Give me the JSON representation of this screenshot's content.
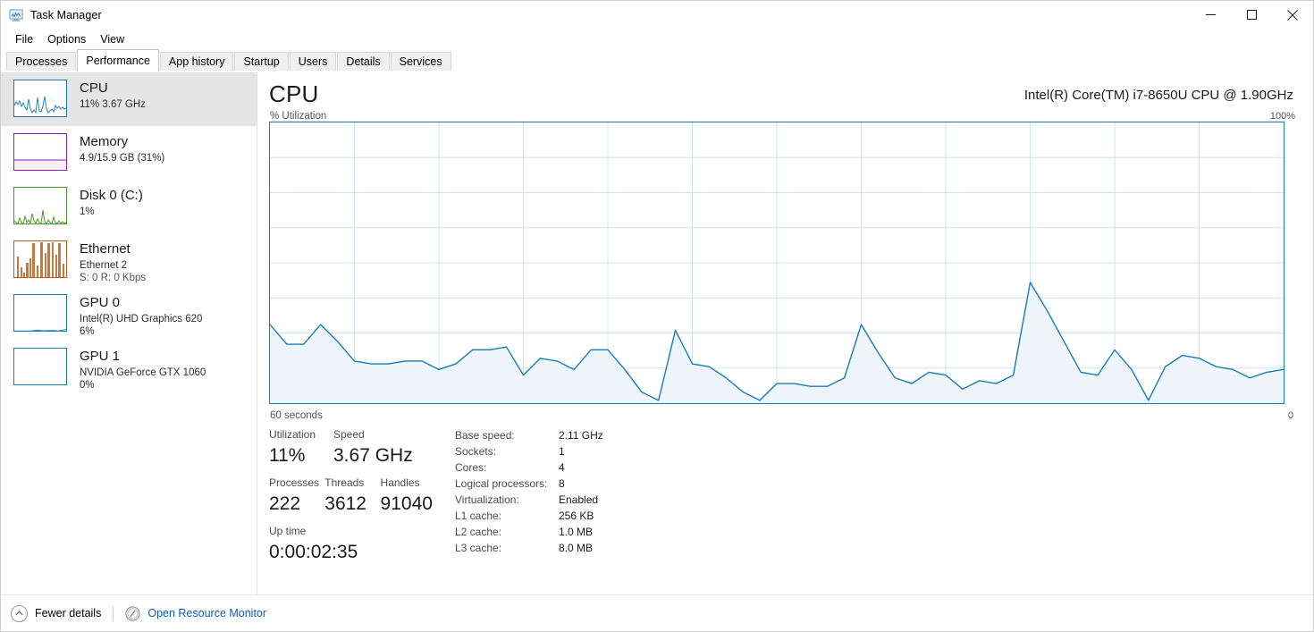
{
  "window": {
    "title": "Task Manager",
    "icon": "task-manager-icon",
    "controls": {
      "minimize": "—",
      "maximize": "□",
      "close": "✕"
    }
  },
  "menu": {
    "items": [
      "File",
      "Options",
      "View"
    ]
  },
  "tabs": {
    "items": [
      {
        "label": "Processes",
        "active": false
      },
      {
        "label": "Performance",
        "active": true
      },
      {
        "label": "App history",
        "active": false
      },
      {
        "label": "Startup",
        "active": false
      },
      {
        "label": "Users",
        "active": false
      },
      {
        "label": "Details",
        "active": false
      },
      {
        "label": "Services",
        "active": false
      }
    ]
  },
  "sidebar": {
    "items": [
      {
        "name": "CPU",
        "line1": "11%  3.67 GHz",
        "line2": "",
        "line3": "",
        "color": "#1a7bb9",
        "selected": true
      },
      {
        "name": "Memory",
        "line1": "4.9/15.9 GB (31%)",
        "line2": "",
        "line3": "",
        "color": "#8f22a8",
        "selected": false
      },
      {
        "name": "Disk 0 (C:)",
        "line1": "1%",
        "line2": "",
        "line3": "",
        "color": "#4a9a2a",
        "selected": false
      },
      {
        "name": "Ethernet",
        "line1": "Ethernet 2",
        "line2": "S: 0 R: 0 Kbps",
        "line3": "",
        "color": "#c05a1e",
        "selected": false
      },
      {
        "name": "GPU 0",
        "line1": "Intel(R) UHD Graphics 620",
        "line2": "6%",
        "line3": "",
        "color": "#1a7bb9",
        "selected": false
      },
      {
        "name": "GPU 1",
        "line1": "NVIDIA GeForce GTX 1060",
        "line2": "0%",
        "line3": "",
        "color": "#1a7bb9",
        "selected": false
      }
    ]
  },
  "main": {
    "heading": "CPU",
    "model": "Intel(R) Core(TM) i7-8650U CPU @ 1.90GHz",
    "axis_top_left": "% Utilization",
    "axis_top_right": "100%",
    "axis_bottom_left": "60 seconds",
    "axis_bottom_right": "0",
    "stats": {
      "utilization_label": "Utilization",
      "utilization_value": "11%",
      "speed_label": "Speed",
      "speed_value": "3.67 GHz",
      "processes_label": "Processes",
      "processes_value": "222",
      "threads_label": "Threads",
      "threads_value": "3612",
      "handles_label": "Handles",
      "handles_value": "91040",
      "uptime_label": "Up time",
      "uptime_value": "0:00:02:35"
    },
    "info": [
      {
        "label": "Base speed:",
        "value": "2.11 GHz"
      },
      {
        "label": "Sockets:",
        "value": "1"
      },
      {
        "label": "Cores:",
        "value": "4"
      },
      {
        "label": "Logical processors:",
        "value": "8"
      },
      {
        "label": "Virtualization:",
        "value": "Enabled"
      },
      {
        "label": "L1 cache:",
        "value": "256 KB"
      },
      {
        "label": "L2 cache:",
        "value": "1.0 MB"
      },
      {
        "label": "L3 cache:",
        "value": "8.0 MB"
      }
    ]
  },
  "statusbar": {
    "fewer_details": "Fewer details",
    "open_resource_monitor": "Open Resource Monitor"
  },
  "colors": {
    "cpu_line": "#1a7bb9",
    "cpu_fill": "#eff6fb",
    "grid": "#cfe3f1",
    "link": "#0a5fb4",
    "selected_row": "#e5e5e5"
  },
  "chart_data": {
    "type": "area",
    "title": "CPU % Utilization",
    "xlabel": "60 seconds",
    "ylabel": "% Utilization",
    "xlim": [
      60,
      0
    ],
    "ylim": [
      0,
      100
    ],
    "grid": true,
    "grid_cols": 12,
    "grid_rows": 8,
    "legend": "none",
    "series": [
      {
        "name": "% Utilization",
        "values": [
          28,
          21,
          21,
          28,
          22,
          15,
          14,
          14,
          15,
          15,
          12,
          14,
          19,
          19,
          20,
          10,
          16,
          15,
          12,
          19,
          19,
          12,
          4,
          1,
          26,
          14,
          13,
          9,
          4,
          1,
          7,
          7,
          6,
          6,
          9,
          28,
          18,
          9,
          7,
          11,
          10,
          5,
          8,
          7,
          10,
          43,
          33,
          22,
          11,
          10,
          19,
          12,
          1,
          13,
          17,
          16,
          13,
          12,
          9,
          11,
          12
        ]
      }
    ]
  }
}
